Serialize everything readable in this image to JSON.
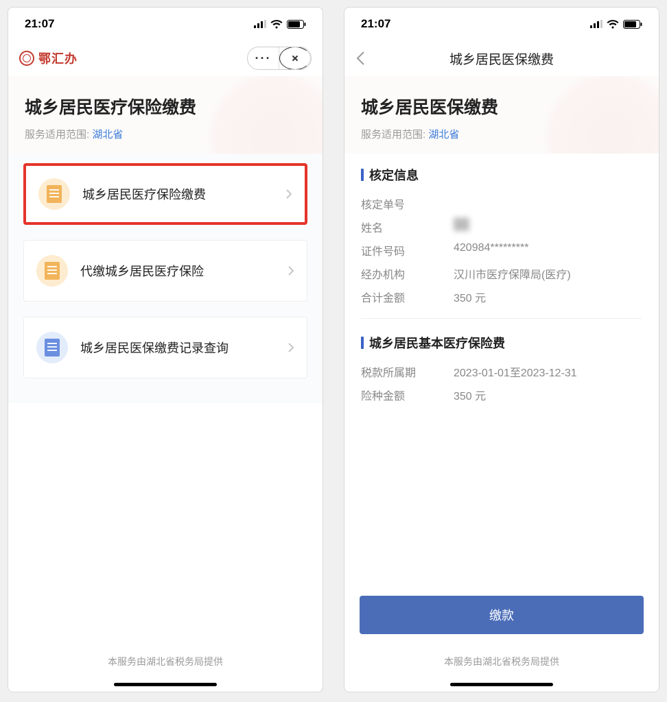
{
  "status": {
    "time": "21:07"
  },
  "left": {
    "brand": "鄂汇办",
    "hero_title": "城乡居民医疗保险缴费",
    "scope_label": "服务适用范围:",
    "scope_value": "湖北省",
    "menu": [
      {
        "label": "城乡居民医疗保险缴费",
        "icon": "doc-orange",
        "highlight": true
      },
      {
        "label": "代缴城乡居民医疗保险",
        "icon": "doc-orange",
        "highlight": false
      },
      {
        "label": "城乡居民医保缴费记录查询",
        "icon": "doc-blue",
        "highlight": false
      }
    ],
    "footer": "本服务由湖北省税务局提供"
  },
  "right": {
    "nav_title": "城乡居民医保缴费",
    "hero_title": "城乡居民医保缴费",
    "scope_label": "服务适用范围:",
    "scope_value": "湖北省",
    "section1_title": "核定信息",
    "fields1": {
      "order_label": "核定单号",
      "order_value": "",
      "name_label": "姓名",
      "name_value": "██",
      "id_label": "证件号码",
      "id_value": "420984*********",
      "org_label": "经办机构",
      "org_value": "汉川市医疗保障局(医疗)",
      "total_label": "合计金额",
      "total_value": "350 元"
    },
    "section2_title": "城乡居民基本医疗保险费",
    "fields2": {
      "period_label": "税款所属期",
      "period_value": "2023-01-01至2023-12-31",
      "amount_label": "险种金额",
      "amount_value": "350 元"
    },
    "pay_button": "缴款",
    "footer": "本服务由湖北省税务局提供"
  }
}
